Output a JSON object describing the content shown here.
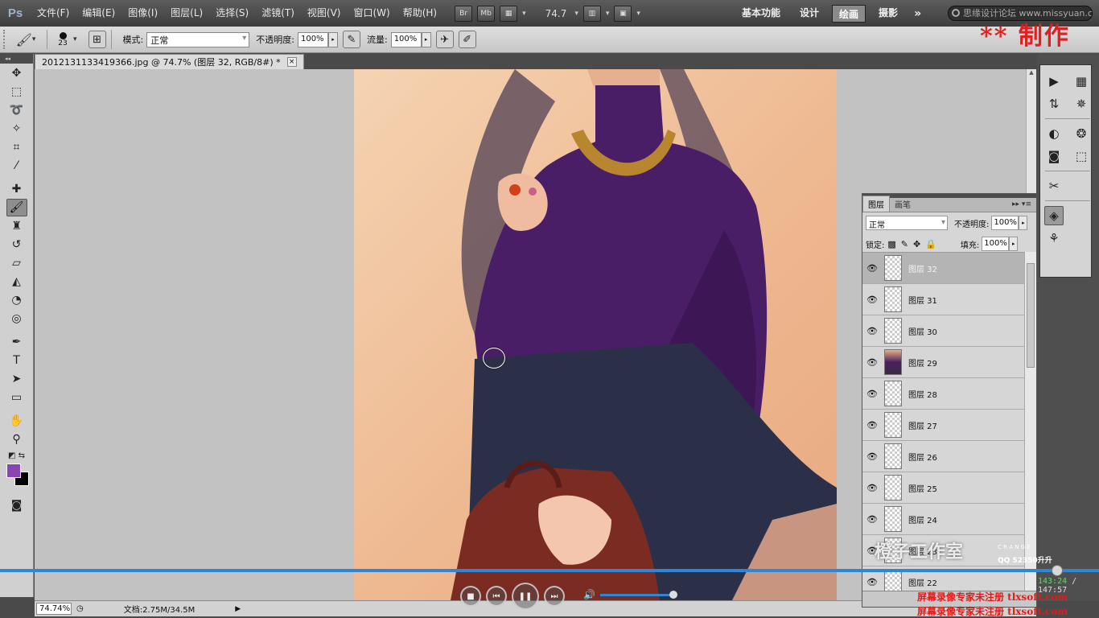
{
  "app": {
    "logo": "Ps"
  },
  "menu": [
    "文件(F)",
    "编辑(E)",
    "图像(I)",
    "图层(L)",
    "选择(S)",
    "滤镜(T)",
    "视图(V)",
    "窗口(W)",
    "帮助(H)"
  ],
  "menubar": {
    "br": "Br",
    "mb": "Mb",
    "zoom": "74.7",
    "search_text": "思缘设计论坛 www.missyuan.com"
  },
  "workspaces": [
    "基本功能",
    "设计",
    "绘画",
    "摄影"
  ],
  "workspace_active": "绘画",
  "options": {
    "brush_size": "23",
    "mode_label": "模式:",
    "mode_value": "正常",
    "opacity_label": "不透明度:",
    "opacity_value": "100%",
    "flow_label": "流量:",
    "flow_value": "100%"
  },
  "stamp": "** 制作",
  "document": {
    "tab_title": "2012131133419366.jpg @ 74.7% (图层 32, RGB/8#) *",
    "zoom_field": "74.74%",
    "doc_info": "文档:2.75M/34.5M"
  },
  "layers_panel": {
    "tabs": [
      "图层",
      "画笔"
    ],
    "blend_mode": "正常",
    "opacity_label": "不透明度:",
    "opacity_value": "100%",
    "lock_label": "锁定:",
    "fill_label": "填充:",
    "fill_value": "100%",
    "layers": [
      {
        "name": "图层 32",
        "selected": true,
        "thumb": "transparent"
      },
      {
        "name": "图层 31",
        "selected": false,
        "thumb": "transparent"
      },
      {
        "name": "图层 30",
        "selected": false,
        "thumb": "transparent"
      },
      {
        "name": "图层 29",
        "selected": false,
        "thumb": "photo"
      },
      {
        "name": "图层 28",
        "selected": false,
        "thumb": "transparent"
      },
      {
        "name": "图层 27",
        "selected": false,
        "thumb": "transparent"
      },
      {
        "name": "图层 26",
        "selected": false,
        "thumb": "transparent"
      },
      {
        "name": "图层 25",
        "selected": false,
        "thumb": "transparent"
      },
      {
        "name": "图层 24",
        "selected": false,
        "thumb": "transparent"
      },
      {
        "name": "图层 23",
        "selected": false,
        "thumb": "transparent"
      },
      {
        "name": "图层 22",
        "selected": false,
        "thumb": "transparent"
      }
    ]
  },
  "colors": {
    "foreground": "#8a44b4",
    "background": "#000000",
    "player_accent": "#2f86d6"
  },
  "player": {
    "progress": 0.957,
    "current_time": "143:24",
    "total_time": "147:57",
    "volume": 1.0
  },
  "watermarks": {
    "studio": "橙子工作室",
    "qq": "QQ 52350升升",
    "recorder": "屏幕录像专家未注册 tlxsoft.com",
    "recorder2": "屏幕录像专家未注册 tlxsoft.com"
  }
}
